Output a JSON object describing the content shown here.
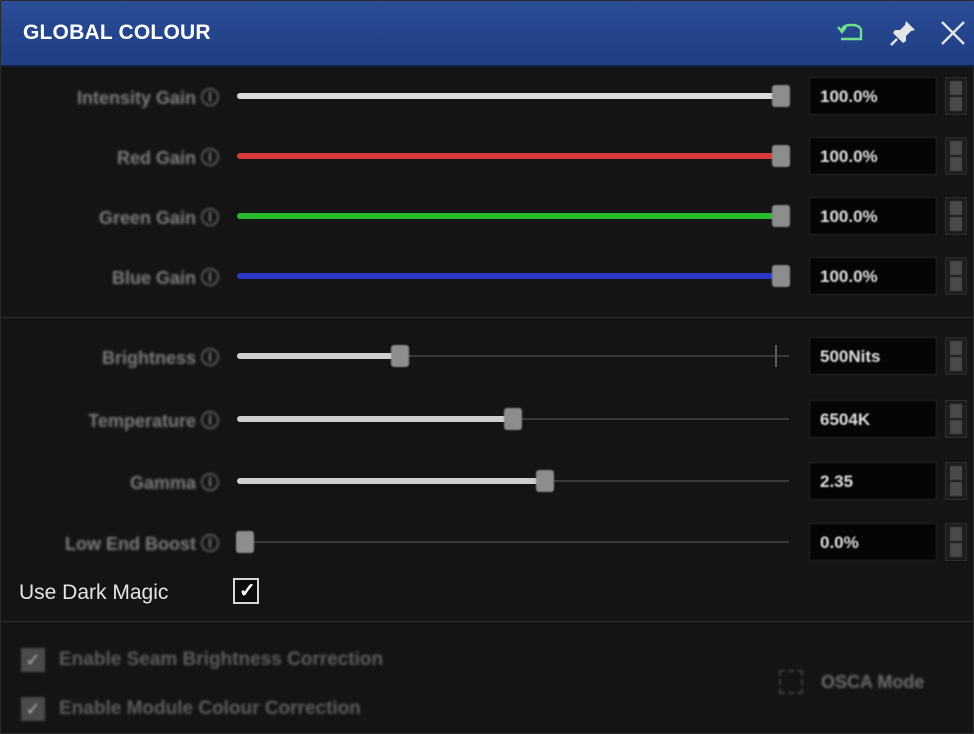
{
  "window": {
    "title": "GLOBAL COLOUR",
    "icons": [
      "reset-icon",
      "pin-icon",
      "close-icon"
    ]
  },
  "gain_rows": [
    {
      "label": "Intensity Gain ⓘ",
      "value": "100.0%",
      "level": 1.0,
      "color": "#d9d9d9"
    },
    {
      "label": "Red Gain ⓘ",
      "value": "100.0%",
      "level": 1.0,
      "color": "#d63a3a"
    },
    {
      "label": "Green Gain ⓘ",
      "value": "100.0%",
      "level": 1.0,
      "color": "#27b82e"
    },
    {
      "label": "Blue Gain ⓘ",
      "value": "100.0%",
      "level": 1.0,
      "color": "#2b35c8"
    }
  ],
  "adjust_rows": [
    {
      "label": "Brightness ⓘ",
      "value": "500Nits",
      "level": 0.29,
      "color": "#cfcfcf"
    },
    {
      "label": "Temperature ⓘ",
      "value": "6504K",
      "level": 0.5,
      "color": "#cfcfcf"
    },
    {
      "label": "Gamma ⓘ",
      "value": "2.35",
      "level": 0.56,
      "color": "#cfcfcf"
    },
    {
      "label": "Low End Boost ⓘ",
      "value": "0.0%",
      "level": 0.0,
      "color": "#cfcfcf"
    }
  ],
  "dark_magic": {
    "label": "Use Dark Magic",
    "checked": true,
    "checkmark": "✓"
  },
  "options": {
    "seam": {
      "label": "Enable Seam Brightness Correction",
      "checked": true,
      "checkmark": "✓"
    },
    "module": {
      "label": "Enable Module Colour Correction",
      "checked": true,
      "checkmark": "✓"
    },
    "osca": {
      "label": "OSCA Mode",
      "checked": false
    }
  }
}
